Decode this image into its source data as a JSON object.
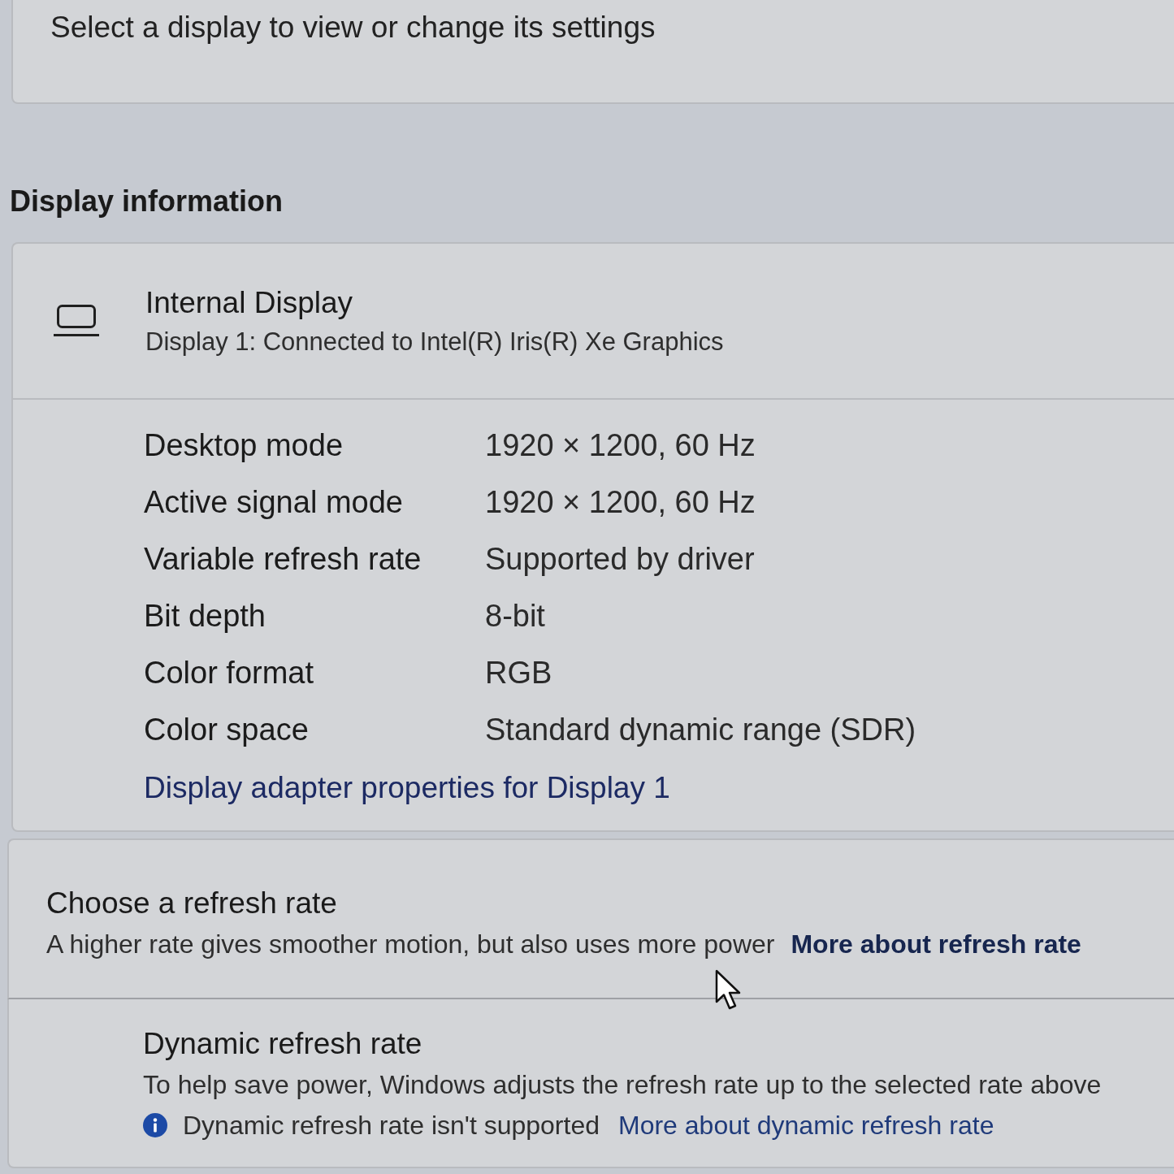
{
  "display_picker": {
    "text": "Select a display to view or change its settings"
  },
  "display_information": {
    "heading": "Display information",
    "display": {
      "title": "Internal Display",
      "subtitle": "Display 1: Connected to Intel(R) Iris(R) Xe Graphics"
    },
    "properties": [
      {
        "label": "Desktop mode",
        "value": "1920 × 1200, 60 Hz"
      },
      {
        "label": "Active signal mode",
        "value": "1920 × 1200, 60 Hz"
      },
      {
        "label": "Variable refresh rate",
        "value": "Supported by driver"
      },
      {
        "label": "Bit depth",
        "value": "8-bit"
      },
      {
        "label": "Color format",
        "value": "RGB"
      },
      {
        "label": "Color space",
        "value": "Standard dynamic range (SDR)"
      }
    ],
    "link": "Display adapter properties for Display 1"
  },
  "refresh_rate": {
    "title": "Choose a refresh rate",
    "description": "A higher rate gives smoother motion, but also uses more power",
    "link": "More about refresh rate"
  },
  "dynamic_refresh_rate": {
    "title": "Dynamic refresh rate",
    "description": "To help save power, Windows adjusts the refresh rate up to the selected rate above",
    "notice": "Dynamic refresh rate isn't supported",
    "link": "More about dynamic refresh rate"
  }
}
